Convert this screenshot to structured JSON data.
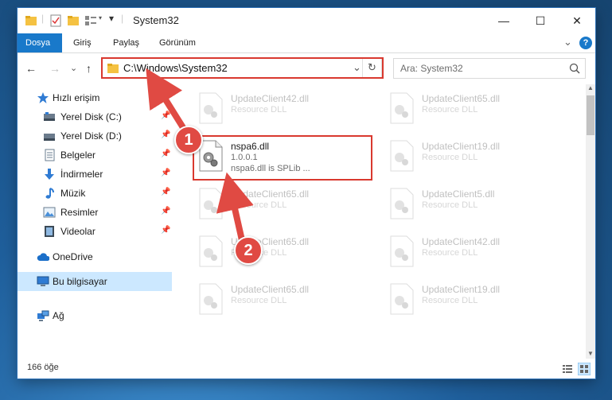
{
  "window": {
    "title": "System32",
    "controls": {
      "minimize": "—",
      "maximize": "☐",
      "close": "✕"
    }
  },
  "ribbon": {
    "tabs": [
      "Dosya",
      "Giriş",
      "Paylaş",
      "Görünüm"
    ],
    "active_tab": "Dosya",
    "help": "?",
    "expand": "⌄"
  },
  "nav": {
    "back": "←",
    "forward": "→",
    "recent": "⌄",
    "up": "↑",
    "address": "C:\\Windows\\System32",
    "refresh": "↻",
    "dropdown": "⌄",
    "search_placeholder": "Ara: System32"
  },
  "sidebar": {
    "items": [
      {
        "label": "Hızlı erişim",
        "icon": "star-icon"
      },
      {
        "label": "Yerel Disk (C:)",
        "icon": "drive-icon",
        "pinned": true
      },
      {
        "label": "Yerel Disk (D:)",
        "icon": "drive-icon",
        "pinned": true
      },
      {
        "label": "Belgeler",
        "icon": "documents-icon",
        "pinned": true
      },
      {
        "label": "İndirmeler",
        "icon": "downloads-icon",
        "pinned": true
      },
      {
        "label": "Müzik",
        "icon": "music-icon",
        "pinned": true
      },
      {
        "label": "Resimler",
        "icon": "pictures-icon",
        "pinned": true
      },
      {
        "label": "Videolar",
        "icon": "videos-icon",
        "pinned": true
      },
      {
        "label": "OneDrive",
        "icon": "cloud-icon"
      },
      {
        "label": "Bu bilgisayar",
        "icon": "computer-icon",
        "selected": true
      },
      {
        "label": "Ağ",
        "icon": "network-icon"
      }
    ],
    "pin_glyph": "📌"
  },
  "files": [
    {
      "name": "UpdateClient42.dll",
      "desc": "Resource DLL",
      "faded": true
    },
    {
      "name": "UpdateClient65.dll",
      "desc": "Resource DLL",
      "faded": true
    },
    {
      "name": "nspa6.dll",
      "desc": "1.0.0.1",
      "desc2": "nspa6.dll is SPLib ...",
      "faded": false
    },
    {
      "name": "UpdateClient19.dll",
      "desc": "Resource DLL",
      "faded": true
    },
    {
      "name": "UpdateClient65.dll",
      "desc": "Resource DLL",
      "faded": true
    },
    {
      "name": "UpdateClient5.dll",
      "desc": "Resource DLL",
      "faded": true
    },
    {
      "name": "UpdateClient65.dll",
      "desc": "Resource DLL",
      "faded": true
    },
    {
      "name": "UpdateClient42.dll",
      "desc": "Resource DLL",
      "faded": true
    },
    {
      "name": "UpdateClient65.dll",
      "desc": "Resource DLL",
      "faded": true
    },
    {
      "name": "UpdateClient19.dll",
      "desc": "Resource DLL",
      "faded": true
    }
  ],
  "status": {
    "count": "166 öğe"
  },
  "annotations": {
    "badge1": "1",
    "badge2": "2"
  },
  "colors": {
    "accent": "#1979ca",
    "annotation_red": "#d9392f",
    "selected": "#cce8ff"
  }
}
